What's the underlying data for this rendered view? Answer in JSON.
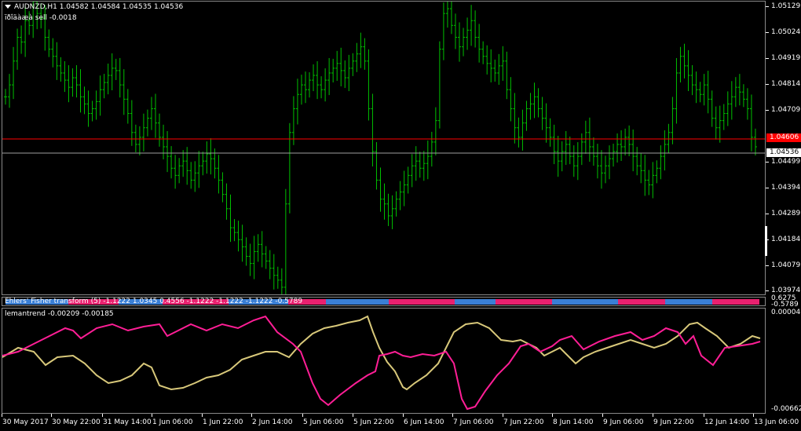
{
  "window": {
    "symbol_line": "AUDNZD,H1  1.04582 1.04584 1.04535 1.04536",
    "indicator_line": "ïðîäàæà sell -0.0018"
  },
  "price_axis": {
    "labels": [
      "1.05129",
      "1.05024",
      "1.04919",
      "1.04814",
      "1.04709",
      "1.04499",
      "1.04394",
      "1.04289",
      "1.04184",
      "1.04079",
      "1.03974"
    ],
    "red_line_label": "1.04606",
    "grey_line_label": "1.04536",
    "red_line_color": "#ff0000",
    "grey_line_color": "#a0a0a0"
  },
  "fisher_panel": {
    "label": "Ehlers' Fisher transform (5) -1.1222 1.0345 0.4556 -1.1222 -1.1222 -1.1222 -0.5789",
    "axis_labels": [
      "0.6275",
      "-0.5789"
    ],
    "colors": {
      "positive": "#3a7fd5",
      "negative": "#e8216f"
    }
  },
  "leman_panel": {
    "label": "lemantrend -0.00209 -0.00185",
    "axis_labels": [
      "0.00004",
      "-0.00662"
    ],
    "colors": {
      "line1": "#ff1e96",
      "line2": "#d8c87a"
    }
  },
  "time_axis": {
    "labels": [
      "30 May 2017",
      "30 May 22:00",
      "31 May 14:00",
      "1 Jun 06:00",
      "1 Jun 22:00",
      "2 Jun 14:00",
      "5 Jun 06:00",
      "5 Jun 22:00",
      "6 Jun 14:00",
      "7 Jun 06:00",
      "7 Jun 22:00",
      "8 Jun 14:00",
      "9 Jun 06:00",
      "9 Jun 22:00",
      "12 Jun 14:00",
      "13 Jun 06:00"
    ]
  },
  "chart_data": {
    "type": "bar",
    "title": "AUDNZD,H1",
    "bar_color": "#00c000",
    "ylim": [
      1.0392,
      1.0515
    ],
    "price_closes": [
      1.0475,
      1.048,
      1.049,
      1.05,
      1.0498,
      1.0507,
      1.0505,
      1.0515,
      1.051,
      1.0508,
      1.05,
      1.0495,
      1.0492,
      1.0488,
      1.0485,
      1.0482,
      1.0479,
      1.0483,
      1.048,
      1.0475,
      1.0472,
      1.0468,
      1.047,
      1.0473,
      1.0478,
      1.0481,
      1.0484,
      1.0487,
      1.0486,
      1.048,
      1.0474,
      1.0468,
      1.046,
      1.0455,
      1.0458,
      1.0462,
      1.0466,
      1.047,
      1.0464,
      1.0458,
      1.0454,
      1.045,
      1.0445,
      1.0442,
      1.0446,
      1.0448,
      1.0444,
      1.044,
      1.0443,
      1.0446,
      1.0448,
      1.0451,
      1.0449,
      1.0445,
      1.044,
      1.0434,
      1.0428,
      1.042,
      1.0418,
      1.0415,
      1.0412,
      1.0408,
      1.0405,
      1.041,
      1.0413,
      1.0409,
      1.0406,
      1.0403,
      1.04,
      1.0398,
      1.0395,
      1.043,
      1.046,
      1.047,
      1.0476,
      1.048,
      1.0478,
      1.0482,
      1.0484,
      1.048,
      1.0478,
      1.0482,
      1.0485,
      1.0487,
      1.0489,
      1.0486,
      1.0483,
      1.0487,
      1.049,
      1.0493,
      1.0496,
      1.049,
      1.047,
      1.0452,
      1.044,
      1.0432,
      1.043,
      1.0425,
      1.0428,
      1.0432,
      1.0435,
      1.0438,
      1.0442,
      1.0446,
      1.0448,
      1.0445,
      1.0447,
      1.045,
      1.0456,
      1.0465,
      1.0495,
      1.051,
      1.0512,
      1.0505,
      1.05,
      1.0496,
      1.05,
      1.0503,
      1.0507,
      1.05,
      1.0495,
      1.0492,
      1.0489,
      1.0487,
      1.0485,
      1.0488,
      1.049,
      1.0478,
      1.047,
      1.0462,
      1.0458,
      1.0464,
      1.047,
      1.0472,
      1.0475,
      1.047,
      1.0466,
      1.0462,
      1.0458,
      1.0452,
      1.0448,
      1.0452,
      1.0455,
      1.045,
      1.0446,
      1.045,
      1.0456,
      1.046,
      1.0454,
      1.045,
      1.0446,
      1.0443,
      1.0446,
      1.0449,
      1.0452,
      1.0455,
      1.0454,
      1.0458,
      1.0455,
      1.045,
      1.0446,
      1.0444,
      1.044,
      1.0438,
      1.0442,
      1.0445,
      1.045,
      1.0455,
      1.046,
      1.047,
      1.0485,
      1.0492,
      1.0488,
      1.0484,
      1.048,
      1.0478,
      1.0476,
      1.048,
      1.0474,
      1.0466,
      1.0462,
      1.0465,
      1.0468,
      1.0472,
      1.0475,
      1.0479,
      1.0477,
      1.0474,
      1.047,
      1.0458,
      1.0454
    ]
  }
}
